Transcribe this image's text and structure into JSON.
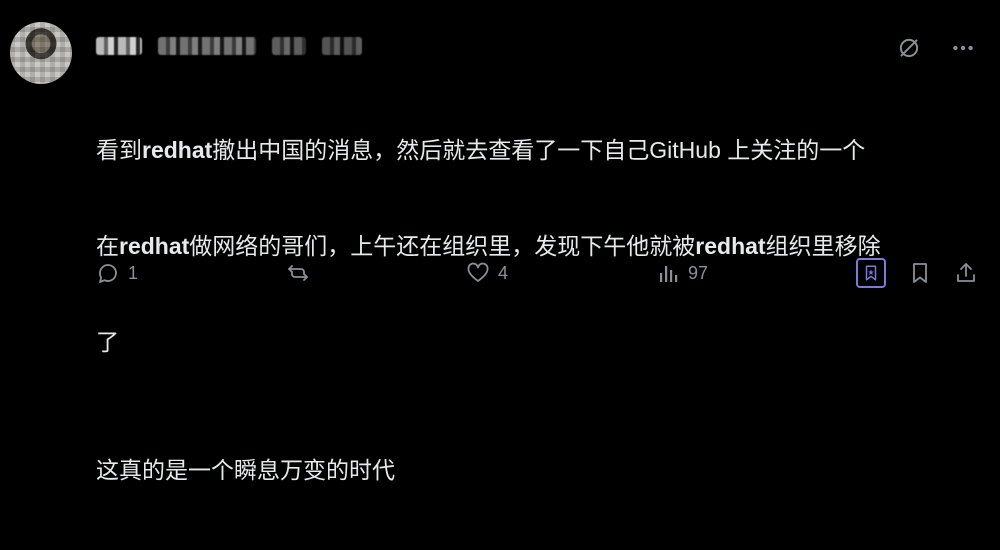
{
  "post": {
    "author": {
      "display_name": "████",
      "handle": "@████ ██████"
    },
    "content": {
      "line1_a": "看到",
      "line1_b": "redhat",
      "line1_c": "撤出中国的消息，然后就去查看了一下自己GitHub 上关注的一个",
      "line2_a": "在",
      "line2_b": "redhat",
      "line2_c": "做网络的哥们，上午还在组织里，发现下午他就被",
      "line2_d": "redhat",
      "line2_e": "组织里移除",
      "line3": "了",
      "line4": "这真的是一个瞬息万变的时代"
    },
    "stats": {
      "replies": "1",
      "reposts": "",
      "likes": "4",
      "views": "97"
    }
  },
  "colors": {
    "background": "#000000",
    "text": "#e7e9ea",
    "muted": "#71767b",
    "accent": "#7d7ad8"
  },
  "icons": {
    "top": [
      "grok-icon",
      "more-icon"
    ],
    "actions": [
      "reply-icon",
      "repost-icon",
      "like-icon",
      "views-icon",
      "bookmark-icon",
      "save-icon",
      "share-icon"
    ]
  }
}
